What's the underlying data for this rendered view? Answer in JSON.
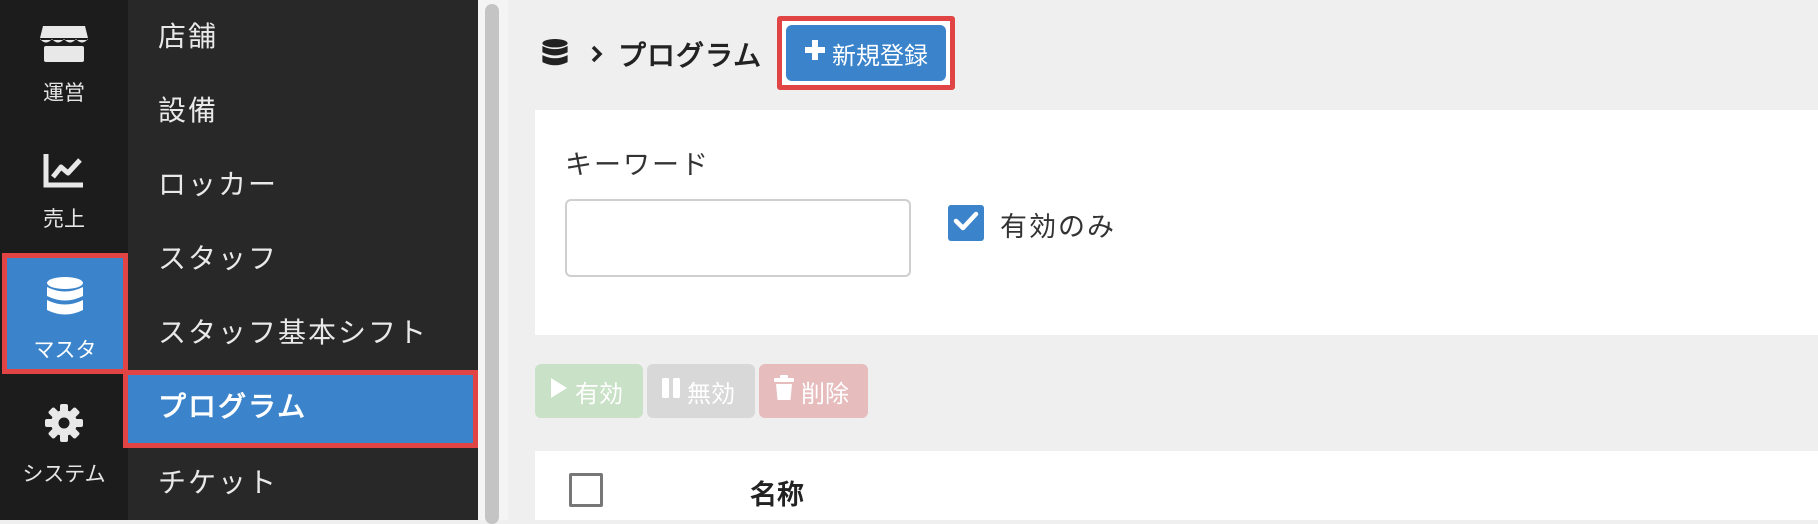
{
  "rail": {
    "items": [
      {
        "label": "運営",
        "icon": "store-icon"
      },
      {
        "label": "売上",
        "icon": "chart-line-icon"
      },
      {
        "label": "マスタ",
        "icon": "database-icon"
      },
      {
        "label": "システム",
        "icon": "gear-icon"
      }
    ]
  },
  "submenu": {
    "items": [
      {
        "label": "店舗"
      },
      {
        "label": "設備"
      },
      {
        "label": "ロッカー"
      },
      {
        "label": "スタッフ"
      },
      {
        "label": "スタッフ基本シフト"
      },
      {
        "label": "プログラム"
      },
      {
        "label": "チケット"
      }
    ]
  },
  "header": {
    "breadcrumb_title": "プログラム",
    "new_button_label": "新規登録"
  },
  "search": {
    "keyword_label": "キーワード",
    "keyword_value": "",
    "active_only_label": "有効のみ",
    "active_only_checked": true
  },
  "actions": {
    "enable_label": "有効",
    "disable_label": "無効",
    "delete_label": "削除"
  },
  "table": {
    "columns": [
      "",
      "名称"
    ]
  },
  "colors": {
    "accent": "#3b84cb",
    "highlight": "#e14444",
    "rail_bg": "#1c1c1c",
    "submenu_bg": "#282828"
  }
}
